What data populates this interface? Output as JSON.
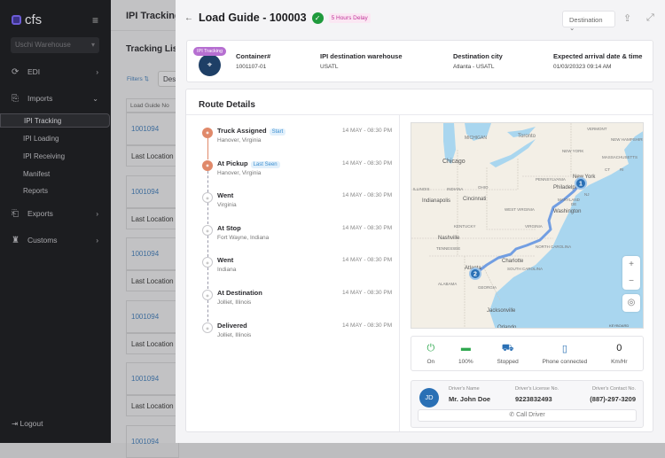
{
  "sidebar": {
    "brand": "cfs",
    "warehouse": "Uschi Warehouse",
    "nav": [
      {
        "label": "EDI",
        "icon": "sync-icon"
      },
      {
        "label": "Imports",
        "icon": "import-icon"
      },
      {
        "label": "Exports",
        "icon": "export-icon"
      },
      {
        "label": "Customs",
        "icon": "customs-icon"
      }
    ],
    "imports_sub": [
      "IPI Tracking",
      "IPI Loading",
      "IPI Receiving",
      "Manifest",
      "Reports"
    ],
    "logout": "Logout"
  },
  "background_page": {
    "title": "IPI Tracking",
    "list_title": "Tracking List",
    "filters": "Filters",
    "select": "Destination",
    "column": "Load Guide No",
    "rows": [
      {
        "id": "1001094",
        "location": "Last Location"
      },
      {
        "id": "1001094",
        "location": "Last Location"
      },
      {
        "id": "1001094",
        "location": "Last Location"
      },
      {
        "id": "1001094",
        "location": "Last Location"
      },
      {
        "id": "1001094",
        "location": "Last Location"
      },
      {
        "id": "1001094"
      }
    ]
  },
  "drawer": {
    "title": "Load Guide - 100003",
    "delay": "5 Hours Delay",
    "dest_select": "Destination",
    "info": {
      "badge": "IPI Tracking",
      "fields": [
        {
          "label": "Container#",
          "value": "1001107-01"
        },
        {
          "label": "IPI destination warehouse",
          "value": "USATL"
        },
        {
          "label": "Destination city",
          "value": "Atlanta - USATL"
        },
        {
          "label": "Expected arrival date & time",
          "value": "01/03/20323 09:14 AM"
        }
      ]
    },
    "route_title": "Route Details",
    "steps": [
      {
        "name": "Truck Assigned",
        "tag": "Start",
        "loc": "Hanover, Virginia",
        "time": "14 MAY - 08:30 PM",
        "done": true
      },
      {
        "name": "At Pickup",
        "tag": "Last Seen",
        "loc": "Hanover, Virginia",
        "time": "14 MAY - 08:30 PM",
        "done": true
      },
      {
        "name": "Went",
        "loc": "Virginia",
        "time": "14 MAY - 08:30 PM",
        "done": false
      },
      {
        "name": "At Stop",
        "loc": "Fort Wayne, Indiana",
        "time": "14 MAY - 08:30 PM",
        "done": false
      },
      {
        "name": "Went",
        "loc": "Indiana",
        "time": "14 MAY - 08:30 PM",
        "done": false
      },
      {
        "name": "At Destination",
        "loc": "Jolliet, Illinois",
        "time": "14 MAY - 08:30 PM",
        "done": false
      },
      {
        "name": "Delivered",
        "loc": "Jolliet, Illinois",
        "time": "14 MAY - 08:30 PM",
        "done": false
      }
    ],
    "map": {
      "labels": [
        "MICHIGAN",
        "Toronto",
        "VERMONT",
        "NEW HAMPSHIRE",
        "NEW YORK",
        "MASSACHUSETTS",
        "CT",
        "RI",
        "Chicago",
        "PENNSYLVANIA",
        "New York",
        "Philadelphia",
        "NJ",
        "ILLINOIS",
        "INDIANA",
        "OHIO",
        "Indianapolis",
        "Cincinnati",
        "MARYLAND",
        "DE",
        "WEST VIRGINIA",
        "Washington",
        "KENTUCKY",
        "VIRGINIA",
        "Nashville",
        "TENNESSEE",
        "NORTH CAROLINA",
        "Charlotte",
        "SOUTH CAROLINA",
        "Atlanta",
        "ALABAMA",
        "GEORGIA",
        "Jacksonville",
        "Orlando",
        "KEYBOARD"
      ],
      "markers": [
        "1",
        "2"
      ],
      "zoom_in": "+",
      "zoom_out": "−"
    },
    "status": [
      {
        "label": "On",
        "icon": "power-icon",
        "value": ""
      },
      {
        "label": "100%",
        "icon": "battery-icon",
        "value": ""
      },
      {
        "label": "Stopped",
        "icon": "truck-icon",
        "value": ""
      },
      {
        "label": "Phone connected",
        "icon": "phone-icon",
        "value": ""
      },
      {
        "label": "Km/Hr",
        "icon": "",
        "value": "0"
      }
    ],
    "driver": {
      "initials": "JD",
      "name_label": "Driver's Name",
      "name": "Mr. John Doe",
      "license_label": "Driver's License No.",
      "license": "9223832493",
      "contact_label": "Driver's Contact No.",
      "contact": "(887)-297-3209",
      "call": "Call Driver"
    }
  }
}
